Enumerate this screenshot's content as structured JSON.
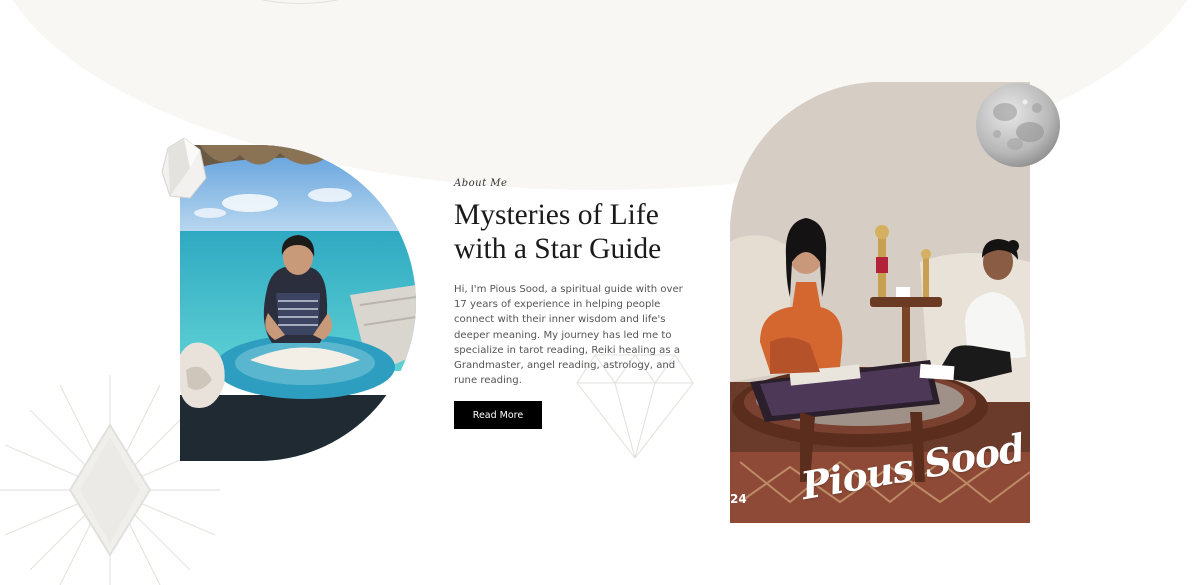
{
  "about": {
    "eyebrow": "About Me",
    "heading_line1": "Mysteries of Life",
    "heading_line2": "with a Star Guide",
    "body": "Hi, I'm Pious Sood, a spiritual guide with over 17 years of experience in helping people connect with their inner wisdom and life's deeper meaning. My journey has led me to specialize in tarot reading, Reiki healing as a Grandmaster, angel reading, astrology, and rune reading.",
    "button_label": "Read More"
  },
  "photo_right": {
    "watermark": "Pious Sood",
    "corner_text": "24"
  },
  "colors": {
    "background": "#ffffff",
    "ellipse": "#f8f7f4",
    "button": "#000000",
    "heading": "#1a1a1a"
  },
  "icons": [
    "crystal-icon",
    "moon-icon",
    "star-decoration-icon",
    "diamond-decoration-icon"
  ]
}
